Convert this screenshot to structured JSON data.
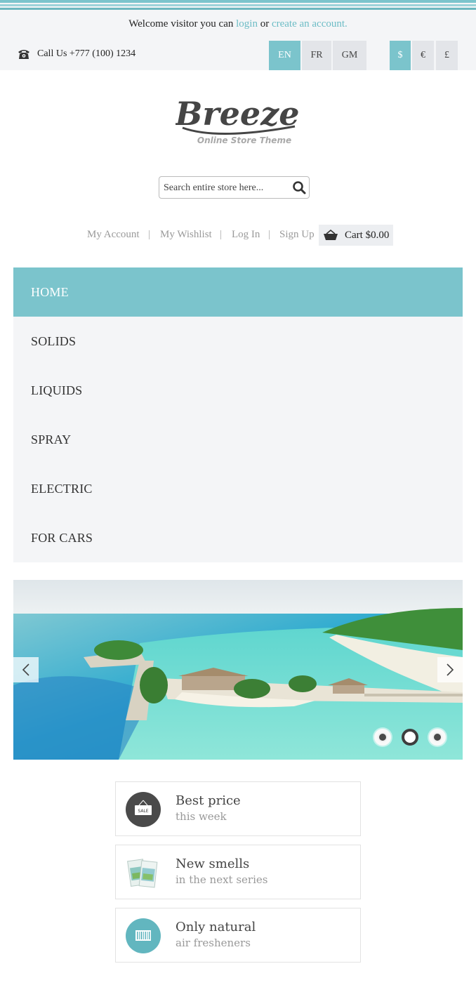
{
  "topbar": {
    "welcome_prefix": "Welcome visitor you can",
    "login_link": "login",
    "or_text": "or",
    "create_account_link": "create an account.",
    "call_text": "Call Us +777 (100) 1234",
    "languages": [
      "EN",
      "FR",
      "GM"
    ],
    "active_language": "EN",
    "currencies": [
      "$",
      "€",
      "£"
    ],
    "active_currency": "$"
  },
  "logo": {
    "title": "Breeze",
    "subtitle": "Online Store Theme"
  },
  "search": {
    "placeholder": "Search entire store here..."
  },
  "account_links": {
    "my_account": "My Account",
    "my_wishlist": "My Wishlist",
    "log_in": "Log In",
    "sign_up": "Sign Up",
    "separator": "|",
    "cart_label": "Cart $0.00"
  },
  "menu": {
    "items": [
      "HOME",
      "SOLIDS",
      "LIQUIDS",
      "SPRAY",
      "ELECTRIC",
      "FOR CARS"
    ],
    "active": "HOME"
  },
  "slider": {
    "slide_count": 3,
    "active_slide": 2
  },
  "features": [
    {
      "title": "Best price",
      "subtitle": "this week",
      "icon": "sale-tag-icon",
      "icon_text": "SALE"
    },
    {
      "title": "New smells",
      "subtitle": "in the next series",
      "icon": "air-freshener-packs-icon"
    },
    {
      "title": "Only natural",
      "subtitle": "air fresheners",
      "icon": "barcode-icon"
    }
  ],
  "colors": {
    "accent": "#7bc4cc",
    "link": "#6cbcc5",
    "panel": "#f4f5f7",
    "dark_icon": "#4a4a4a"
  }
}
